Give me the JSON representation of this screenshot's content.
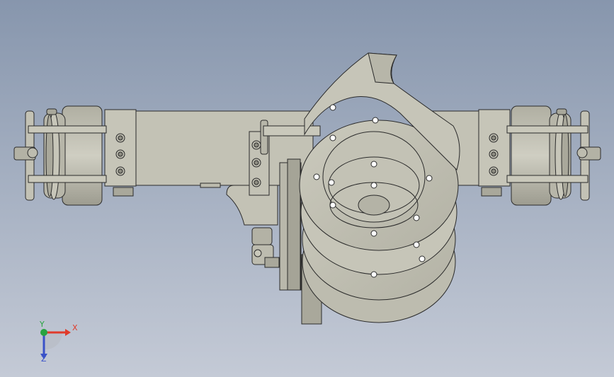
{
  "viewport": {
    "background_top": "#8796ad",
    "background_bottom": "#c4cad6",
    "part_fill": "#c3c2b5",
    "part_shade": "#a9a89b",
    "edge_color": "#2b2b2b"
  },
  "triad": {
    "x_label": "X",
    "y_label": "Y",
    "z_label": "Z",
    "x_color": "#e03a2a",
    "y_color": "#27a340",
    "z_color": "#3a52c8"
  }
}
